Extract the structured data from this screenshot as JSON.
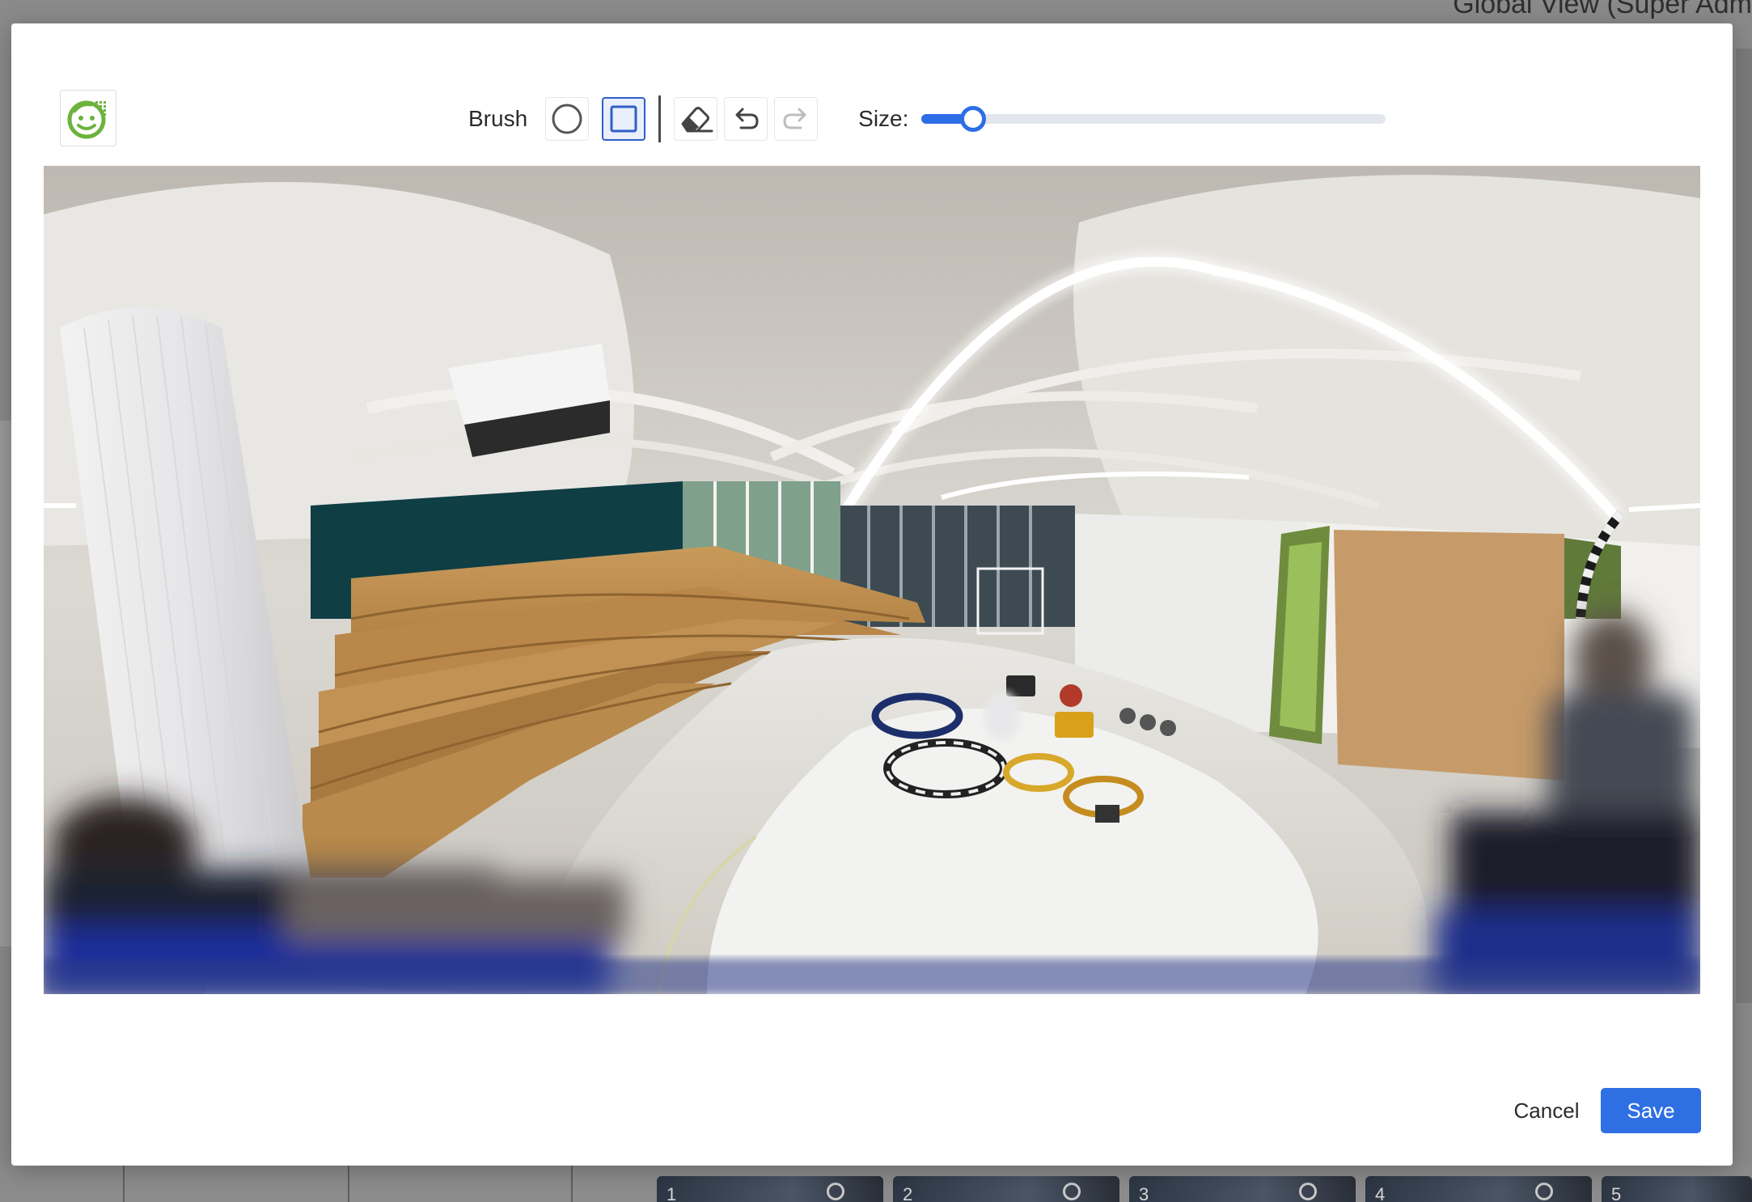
{
  "background": {
    "header_text": "Global View (Super Adm",
    "thumbnails": [
      "1",
      "2",
      "3",
      "4",
      "5"
    ]
  },
  "modal": {
    "logo": {
      "icon": "face-logo-icon"
    },
    "toolbar": {
      "brush_label": "Brush",
      "tools": [
        {
          "id": "circle-brush",
          "icon": "circle-icon",
          "active": false
        },
        {
          "id": "square-brush",
          "icon": "square-icon",
          "active": true
        },
        {
          "id": "eraser",
          "icon": "eraser-icon",
          "active": false
        },
        {
          "id": "undo",
          "icon": "undo-icon",
          "active": false
        },
        {
          "id": "redo",
          "icon": "redo-icon",
          "active": false,
          "disabled": true
        }
      ],
      "size_label": "Size:",
      "size_value": 0.11
    },
    "canvas": {
      "content": "panorama-image"
    },
    "footer": {
      "cancel_label": "Cancel",
      "save_label": "Save"
    }
  },
  "colors": {
    "accent": "#2d6ee8",
    "save_button": "#2f6fe4",
    "active_tool_border": "#2f5fc8",
    "logo_green": "#6cb33e"
  }
}
